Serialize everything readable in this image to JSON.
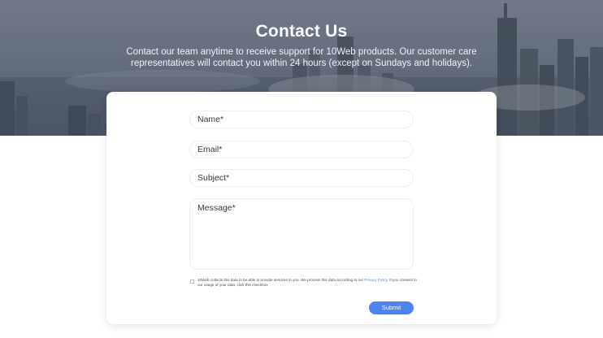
{
  "hero": {
    "title": "Contact Us",
    "description": "Contact our team anytime to receive support for 10Web products. Our customer care representatives will contact you within 24 hours (except on Sundays and holidays)."
  },
  "form": {
    "name_placeholder": "Name*",
    "email_placeholder": "Email*",
    "subject_placeholder": "Subject*",
    "message_placeholder": "Message*",
    "consent_text_before": "10Web collects this data to be able to provide services to you. We process this data according to our ",
    "consent_link": "Privacy Policy",
    "consent_text_after": ". If you consent to our usage of your data, click this checkbox",
    "submit_label": "Submit"
  },
  "colors": {
    "accent": "#4e82f1",
    "link": "#4c7ff0"
  }
}
